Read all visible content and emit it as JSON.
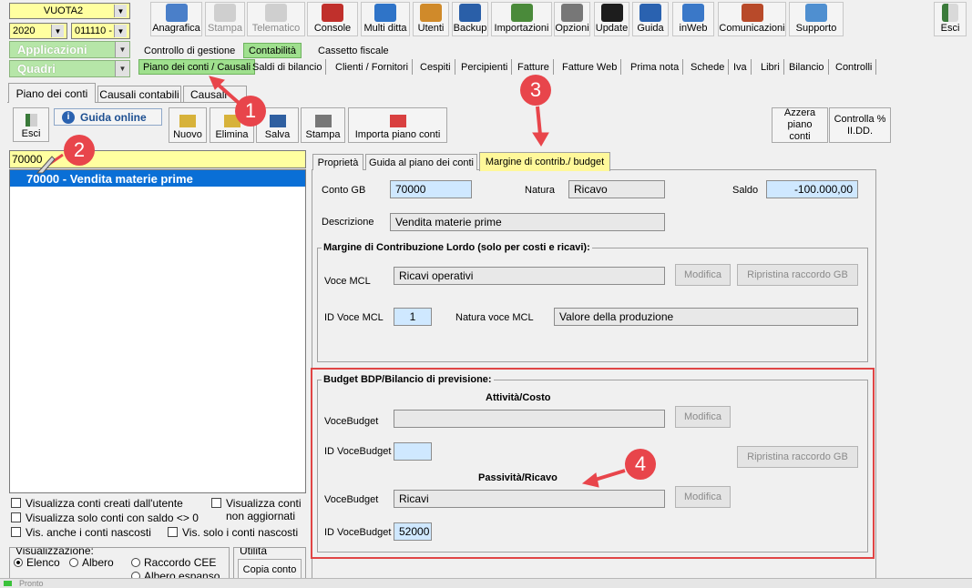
{
  "top_selects": {
    "company": "VUOTA2",
    "year": "2020",
    "code": "011110 -"
  },
  "mode_bars": {
    "applicazioni": "Applicazioni",
    "quadri": "Quadri"
  },
  "toolbar": [
    {
      "label": "Anagrafica",
      "icon": "person-card-icon",
      "enabled": true
    },
    {
      "label": "Stampa",
      "icon": "printer-icon",
      "enabled": false
    },
    {
      "label": "Telematico",
      "icon": "telematic-icon",
      "enabled": false
    },
    {
      "label": "Console",
      "icon": "console-icon",
      "enabled": true
    },
    {
      "label": "Multi ditta",
      "icon": "multi-company-icon",
      "enabled": true
    },
    {
      "label": "Utenti",
      "icon": "users-icon",
      "enabled": true
    },
    {
      "label": "Backup",
      "icon": "backup-icon",
      "enabled": true
    },
    {
      "label": "Importazioni",
      "icon": "import-icon",
      "enabled": true
    },
    {
      "label": "Opzioni",
      "icon": "wrench-icon",
      "enabled": true
    },
    {
      "label": "Update",
      "icon": "update-monitor-icon",
      "enabled": true
    },
    {
      "label": "Guida",
      "icon": "help-icon",
      "enabled": true
    },
    {
      "label": "inWeb",
      "icon": "cloud-icon",
      "enabled": true
    },
    {
      "label": "Comunicazioni",
      "icon": "communications-icon",
      "enabled": true
    },
    {
      "label": "Supporto",
      "icon": "support-icon",
      "enabled": true
    }
  ],
  "exit_top": "Esci",
  "menu_tabs": [
    "Controllo di gestione",
    "Contabilità",
    "Cassetto fiscale"
  ],
  "sub_tabs": [
    "Piano dei conti / Causali",
    "Saldi di bilancio",
    "Clienti / Fornitori",
    "Cespiti",
    "Percipienti",
    "Fatture",
    "Fatture Web",
    "Prima nota",
    "Schede",
    "Iva",
    "Libri",
    "Bilancio",
    "Controlli"
  ],
  "page_tabs": [
    "Piano dei conti",
    "Causali contabili",
    "Causali"
  ],
  "left_toolbar": {
    "esci": "Esci",
    "guida_online": "Guida online"
  },
  "action_buttons": [
    "Nuovo",
    "Elimina",
    "Salva",
    "Stampa",
    "Importa piano conti"
  ],
  "right_buttons": {
    "azzera": "Azzera piano conti",
    "controlla": "Controlla % II.DD."
  },
  "search_value": "70000",
  "account_list": [
    "70000 - Vendita materie prime"
  ],
  "checkboxes": [
    "Visualizza conti creati dall'utente",
    "Visualizza conti non aggiornati",
    "Visualizza solo conti con saldo <> 0",
    "Vis. anche i conti nascosti",
    "Vis. solo i conti nascosti"
  ],
  "view_group": {
    "title": "Visualizzazione:",
    "options": [
      "Elenco",
      "Albero",
      "Raccordo CEE",
      "Albero espanso"
    ],
    "selected": "Elenco"
  },
  "utility_group": {
    "title": "Utilità",
    "button": "Copia conto"
  },
  "detail_tabs": [
    "Proprietà",
    "Guida al piano dei conti",
    "Margine di contrib./ budget"
  ],
  "detail": {
    "conto_gb_label": "Conto GB",
    "conto_gb": "70000",
    "natura_label": "Natura",
    "natura": "Ricavo",
    "saldo_label": "Saldo",
    "saldo": "-100.000,00",
    "descrizione_label": "Descrizione",
    "descrizione": "Vendita materie prime"
  },
  "mcl": {
    "title": "Margine di Contribuzione Lordo (solo per costi e ricavi):",
    "voce_label": "Voce MCL",
    "voce": "Ricavi operativi",
    "modifica": "Modifica",
    "ripristina": "Ripristina raccordo GB",
    "id_label": "ID Voce MCL",
    "id": "1",
    "natura_label": "Natura voce MCL",
    "natura": "Valore della produzione"
  },
  "budget": {
    "title": "Budget BDP/Bilancio di previsione:",
    "attivita_title": "Attività/Costo",
    "voce_label": "VoceBudget",
    "attivita_voce": "",
    "id_label": "ID VoceBudget",
    "attivita_id": "",
    "modifica": "Modifica",
    "ripristina": "Ripristina raccordo GB",
    "passivita_title": "Passività/Ricavo",
    "passivita_voce": "Ricavi",
    "passivita_id": "52000"
  },
  "callouts": [
    "1",
    "2",
    "3",
    "4"
  ],
  "status_text": "Pronto"
}
